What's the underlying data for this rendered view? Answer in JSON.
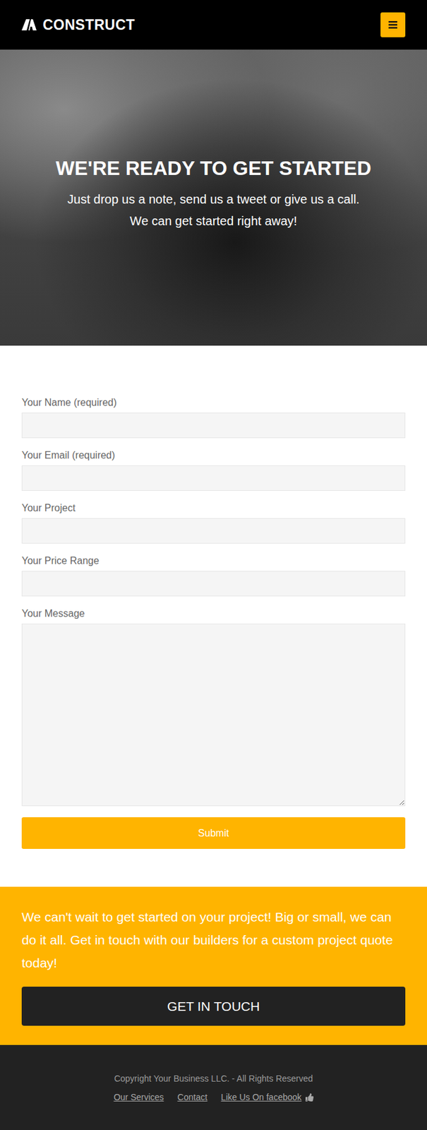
{
  "header": {
    "logo": "CONSTRUCT"
  },
  "hero": {
    "title": "WE'RE READY TO GET STARTED",
    "subtitle_lines": [
      "Just drop us a note, send us a tweet or give us a call.",
      "We can get started right away!"
    ]
  },
  "form": {
    "fields": [
      {
        "label": "Your Name (required)",
        "kind": "input"
      },
      {
        "label": "Your Email (required)",
        "kind": "input"
      },
      {
        "label": "Your Project",
        "kind": "input"
      },
      {
        "label": "Your Price Range",
        "kind": "input"
      },
      {
        "label": "Your Message",
        "kind": "textarea"
      }
    ],
    "submit": "Submit"
  },
  "cta": {
    "text": "We can't wait to get started on your project! Big or small, we can do it all. Get in touch with our builders for a custom project quote today!",
    "button": "GET IN TOUCH"
  },
  "footer": {
    "copyright": "Copyright Your Business LLC. - All Rights Reserved",
    "links": [
      {
        "label": "Our Services",
        "kind": "plain"
      },
      {
        "label": "Contact",
        "kind": "plain"
      },
      {
        "label": "Like Us On facebook",
        "kind": "like"
      }
    ]
  }
}
